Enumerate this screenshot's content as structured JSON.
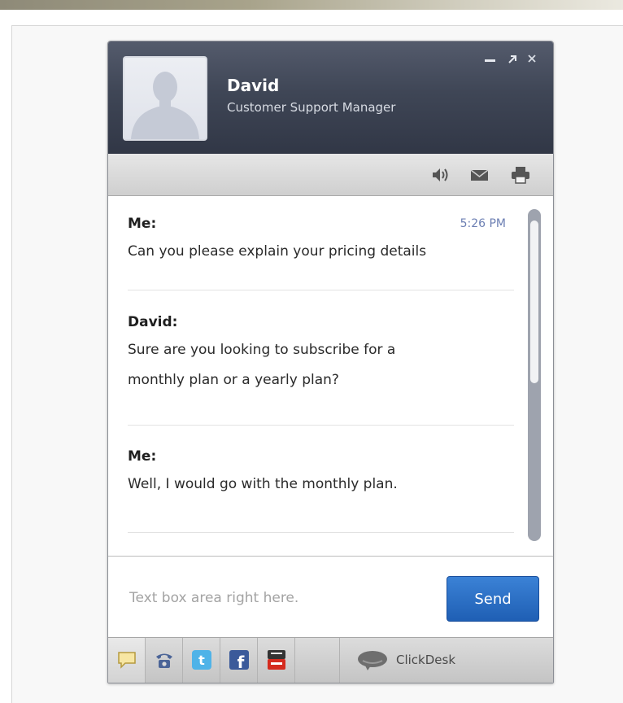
{
  "agent": {
    "name": "David",
    "title": "Customer Support Manager"
  },
  "messages": [
    {
      "sender": "Me:",
      "text": "Can you please explain your pricing details",
      "time": "5:26 PM"
    },
    {
      "sender": "David:",
      "text_lines": [
        "Sure are you looking to subscribe for a",
        "monthly plan or a yearly plan?"
      ]
    },
    {
      "sender": "Me:",
      "text": "Well, I would go with the monthly plan."
    }
  ],
  "composer": {
    "placeholder": "Text box area right here.",
    "send_label": "Send"
  },
  "footer": {
    "brand": "ClickDesk",
    "icons": [
      "chat-icon",
      "phone-icon",
      "twitter-icon",
      "facebook-icon",
      "youtube-icon"
    ]
  },
  "colors": {
    "header": "#3f4656",
    "send_button": "#2b6fc6",
    "timestamp": "#6c7fb3"
  }
}
